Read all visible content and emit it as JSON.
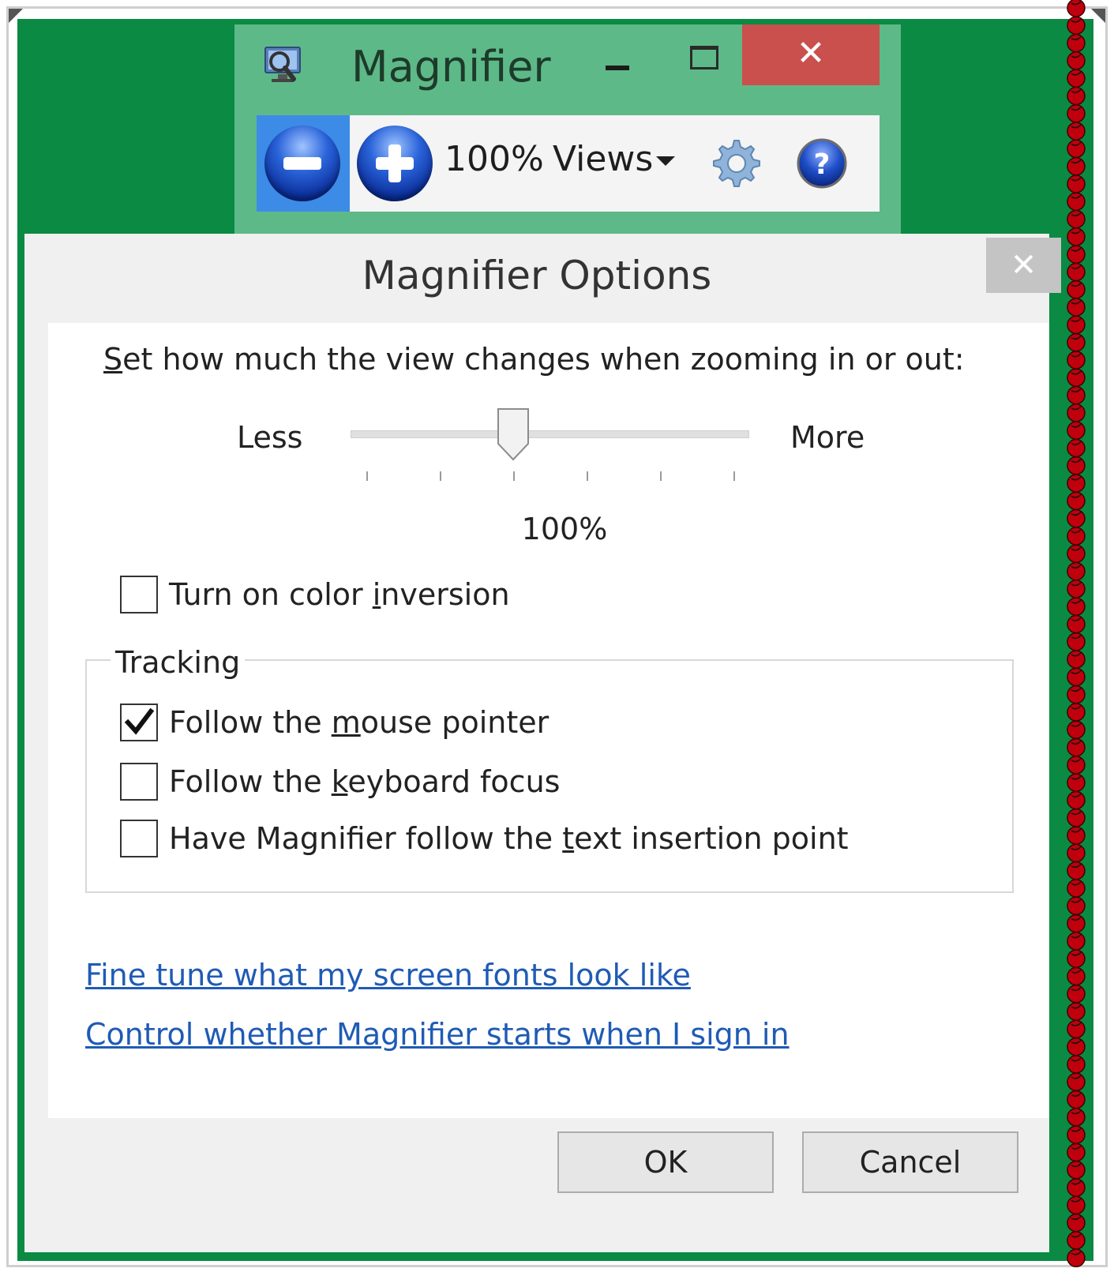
{
  "magnifier_window": {
    "title": "Magnifier",
    "close_glyph": "✕",
    "zoom_level": "100%",
    "views_label": "Views",
    "icons": [
      "magnifier-app-icon",
      "minimize-icon",
      "maximize-icon",
      "close-icon",
      "zoom-out-icon",
      "zoom-in-icon",
      "chevron-down-icon",
      "gear-icon",
      "help-icon"
    ]
  },
  "options_dialog": {
    "title": "Magnifier Options",
    "close_glyph": "✕",
    "zoom_question": {
      "mnemonic": "S",
      "rest": "et how much the view changes when zooming in or out:"
    },
    "slider": {
      "less_label": "Less",
      "more_label": "More",
      "value_label": "100%",
      "tick_count": 6,
      "selected_tick_index": 2
    },
    "color_inversion": {
      "before": "Turn on color ",
      "mnemonic": "i",
      "after": "nversion",
      "checked": false
    },
    "tracking": {
      "legend": "Tracking",
      "mouse": {
        "before": "Follow the ",
        "mnemonic": "m",
        "after": "ouse pointer",
        "checked": true
      },
      "keyboard": {
        "before": "Follow the ",
        "mnemonic": "k",
        "after": "eyboard focus",
        "checked": false
      },
      "text": {
        "before": "Have Magnifier follow the ",
        "mnemonic": "t",
        "after": "ext insertion point",
        "checked": false
      }
    },
    "links": {
      "fonts": "Fine tune what my screen fonts look like",
      "sign_in": "Control whether Magnifier starts when I sign in"
    },
    "buttons": {
      "ok": "OK",
      "cancel": "Cancel"
    }
  },
  "colors": {
    "backdrop_green": "#0b8a43",
    "toolbar_green": "#5eb988",
    "close_red": "#c9504d",
    "link_blue": "#1f5bb5",
    "cherry_red": "#c0000d"
  }
}
